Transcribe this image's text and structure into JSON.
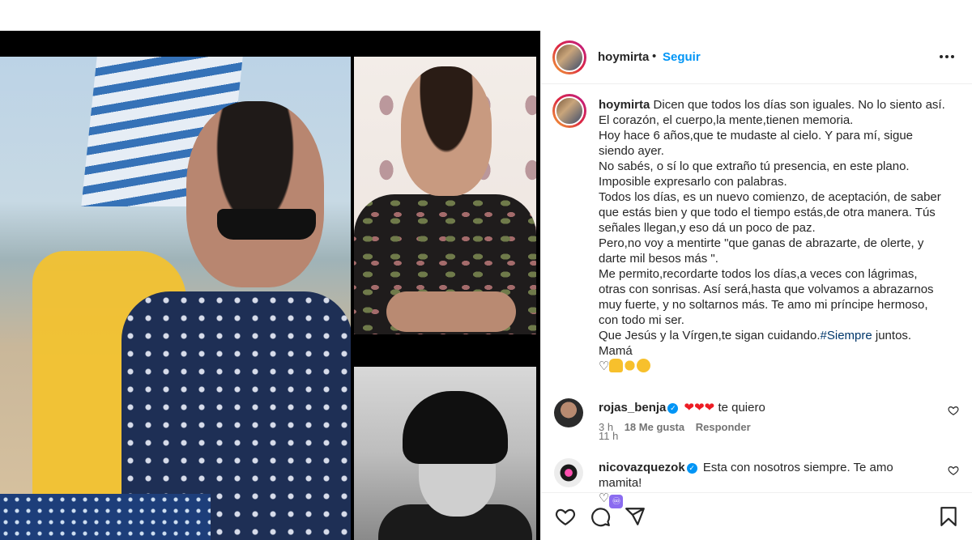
{
  "post": {
    "username": "hoymirta",
    "separator": "•",
    "follow_label": "Seguir",
    "more_label": "•••"
  },
  "caption": {
    "username": "hoymirta",
    "text": "Dicen que todos los días son iguales. No lo siento así.\nEl corazón, el cuerpo,la mente,tienen memoria.\nHoy hace 6 años,que te mudaste al cielo. Y para mí, sigue siendo ayer.\nNo sabés, o sí lo que extraño tú presencia, en este plano.\nImposible expresarlo con palabras.\nTodos los días, es un nuevo comienzo, de aceptación, de saber que estás bien y que todo el tiempo estás,de otra manera. Tús señales llegan,y eso dá un poco de paz.\nPero,no voy a mentirte \"que ganas de abrazarte, de olerte, y darte mil besos más \".\nMe permito,recordarte todos los días,a veces con lágrimas, otras con sonrisas. Así será,hasta que volvamos a abrazarnos muy fuerte, y no soltarnos más. Te amo mi príncipe hermoso, con todo mi ser.\nQue Jesús y la Vírgen,te sigan cuidando.",
    "hashtag": "#Siempre",
    "text_end": " juntos. Mamá",
    "emoji_heart": "♡",
    "time": "11 h"
  },
  "comments": [
    {
      "username": "rojas_benja",
      "hearts": "❤❤❤",
      "text": "te quiero",
      "time": "3 h",
      "likes": "18 Me gusta",
      "reply": "Responder"
    },
    {
      "username": "nicovazquezok",
      "text": "Esta con nosotros siempre. Te amo mamita!",
      "emoji_heart": "♡",
      "emoji_inf": "♾"
    }
  ],
  "colors": {
    "link": "#0095f6",
    "hashtag": "#00376b",
    "secondary_text": "#737373"
  },
  "icons": {
    "header": [
      "more-icon"
    ],
    "actions": [
      "heart-icon",
      "comment-icon",
      "share-icon",
      "bookmark-icon"
    ]
  }
}
